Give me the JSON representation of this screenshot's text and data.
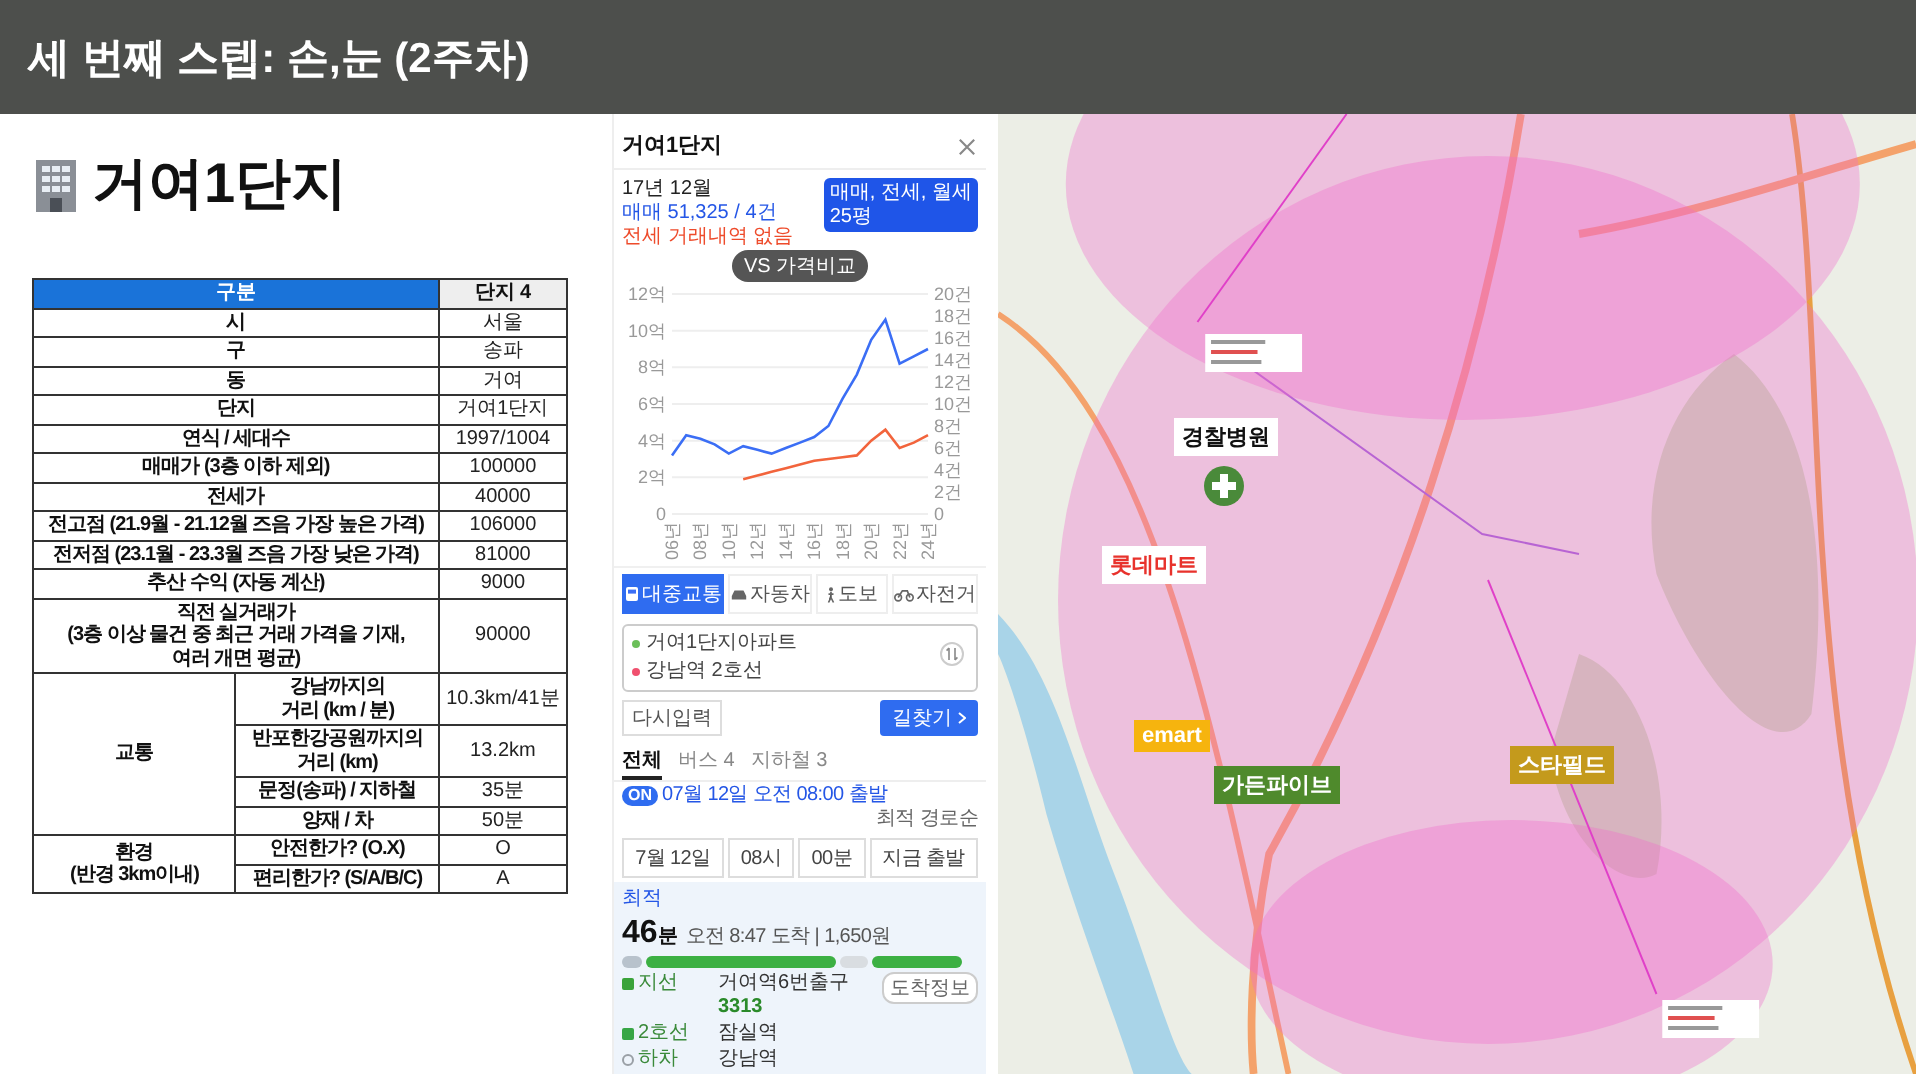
{
  "header": {
    "title": "세 번째 스텝: 손,눈 (2주차)"
  },
  "complex": {
    "title": "거여1단지",
    "table": {
      "columns": [
        "구분",
        "단지 4"
      ],
      "rows": [
        {
          "kind": "single",
          "label": "시",
          "value": "서울"
        },
        {
          "kind": "single",
          "label": "구",
          "value": "송파"
        },
        {
          "kind": "single",
          "label": "동",
          "value": "거여"
        },
        {
          "kind": "single",
          "label": "단지",
          "value": "거여1단지"
        },
        {
          "kind": "single",
          "label": "연식 / 세대수",
          "value": "1997/1004"
        },
        {
          "kind": "single",
          "label": "매매가 (3층 이하 제외)",
          "value": "100000"
        },
        {
          "kind": "single",
          "label": "전세가",
          "value": "40000"
        },
        {
          "kind": "single",
          "label": "전고점 (21.9월 - 21.12월 즈음 가장 높은 가격)",
          "value": "106000"
        },
        {
          "kind": "single",
          "label": "전저점 (23.1월 - 23.3월 즈음 가장 낮은 가격)",
          "value": "81000"
        },
        {
          "kind": "single",
          "label": "추산 수익 (자동 계산)",
          "value": "9000"
        },
        {
          "kind": "single",
          "label": "직전 실거래가\n(3층 이상 물건 중 최근 거래 가격을 기재,\n여러 개면 평균)",
          "value": "90000"
        },
        {
          "kind": "group",
          "label": "교통",
          "items": [
            {
              "label": "강남까지의\n거리 (km / 분)",
              "value": "10.3km/41분"
            },
            {
              "label": "반포한강공원까지의\n거리 (km)",
              "value": "13.2km"
            },
            {
              "label": "문정(송파) / 지하철",
              "value": "35분"
            },
            {
              "label": "양재 / 차",
              "value": "50분"
            }
          ]
        },
        {
          "kind": "group",
          "label": "환경\n(반경 3km이내)",
          "items": [
            {
              "label": "안전한가? (O.X)",
              "value": "O"
            },
            {
              "label": "편리한가? (S/A/B/C)",
              "value": "A"
            }
          ]
        }
      ]
    }
  },
  "app": {
    "title": "거여1단지",
    "period": "17년 12월",
    "sale_summary": "매매 51,325 / 4건",
    "jeonse_summary": "전세 거래내역 없음",
    "filter": {
      "label": "매매, 전세, 월세",
      "sub": "25평"
    },
    "compare_button": "VS 가격비교",
    "chart_data": {
      "type": "line",
      "categories": [
        "06년",
        null,
        "08년",
        null,
        "10년",
        null,
        "12년",
        null,
        "14년",
        null,
        "16년",
        null,
        "18년",
        null,
        "20년",
        null,
        "22년",
        null,
        "24년"
      ],
      "ylim": [
        0,
        12
      ],
      "grid": true,
      "yticks": [
        {
          "value": 0,
          "label": "0"
        },
        {
          "value": 2,
          "label": "2억"
        },
        {
          "value": 4,
          "label": "4억"
        },
        {
          "value": 6,
          "label": "6억"
        },
        {
          "value": 8,
          "label": "8억"
        },
        {
          "value": 10,
          "label": "10억"
        },
        {
          "value": 12,
          "label": "12억"
        }
      ],
      "series": [
        {
          "color": "#3b6ef5",
          "values": [
            3.2,
            4.3,
            4.1,
            3.8,
            3.3,
            3.7,
            3.5,
            3.3,
            3.6,
            3.9,
            4.2,
            4.8,
            6.3,
            7.6,
            9.5,
            10.6,
            8.2,
            8.6,
            9.0
          ]
        },
        {
          "color": "#f2643c",
          "values": [
            null,
            null,
            null,
            null,
            null,
            1.9,
            2.1,
            2.3,
            2.5,
            2.7,
            2.9,
            3.0,
            3.1,
            3.2,
            4.0,
            4.6,
            3.6,
            3.9,
            4.3
          ]
        }
      ]
    },
    "right_axis_labels": [
      "20건",
      "18건",
      "16건",
      "14건",
      "12건",
      "10건",
      "8건",
      "6건",
      "4건",
      "2건",
      "0"
    ],
    "transport_modes": [
      {
        "kind": "transit",
        "label": "대중교통",
        "selected": true
      },
      {
        "kind": "car",
        "label": "자동차",
        "selected": false
      },
      {
        "kind": "walk",
        "label": "도보",
        "selected": false
      },
      {
        "kind": "bike",
        "label": "자전거",
        "selected": false
      }
    ],
    "origin": "거여1단지아파트",
    "destination": "강남역 2호선",
    "reset_button": "다시입력",
    "search_button": "길찾기",
    "result_tabs": [
      {
        "label": "전체",
        "selected": true
      },
      {
        "label": "버스 4",
        "selected": false
      },
      {
        "label": "지하철 3",
        "selected": false
      }
    ],
    "departure": {
      "toggle": "ON",
      "on": true,
      "text": "07월 12일 오전 08:00 출발"
    },
    "sort": "최적 경로순",
    "time_pickers": [
      "7월 12일",
      "08시",
      "00분"
    ],
    "now_button": "지금 출발",
    "route": {
      "badge": "최적",
      "duration": "46",
      "duration_unit": "분",
      "arrival": "오전 8:47 도착 | 1,650원",
      "steps": [
        {
          "kind": "bus",
          "line": "지선",
          "place": "거여역6번출구",
          "sub": "3313",
          "action": "도착정보"
        },
        {
          "kind": "subway",
          "line": "2호선",
          "place": "잠실역"
        },
        {
          "kind": "alight",
          "line": "하차",
          "place": "강남역"
        }
      ]
    }
  },
  "map": {
    "labels": [
      {
        "kind": "light",
        "text": "경찰병원",
        "color": "#ffffff"
      },
      {
        "kind": "accent",
        "text": "롯데마트",
        "color": "#ffffff"
      },
      {
        "kind": "dark",
        "text": "emart",
        "color": "#f6b40e"
      },
      {
        "kind": "dark",
        "text": "가든파이브",
        "color": "#4f8a2c"
      },
      {
        "kind": "dark",
        "text": "스타필드",
        "color": "#c49a1c"
      }
    ]
  }
}
